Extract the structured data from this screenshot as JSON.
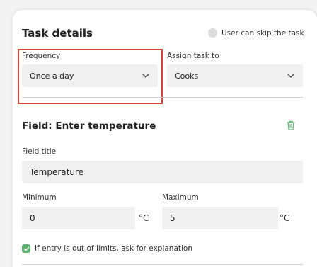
{
  "task_details": {
    "title": "Task details",
    "skip_toggle_label": "User can skip the task",
    "frequency": {
      "label": "Frequency",
      "value": "Once a day"
    },
    "assign": {
      "label": "Assign task to",
      "value": "Cooks"
    }
  },
  "field": {
    "heading": "Field: Enter temperature",
    "title_label": "Field title",
    "title_value": "Temperature",
    "minimum": {
      "label": "Minimum",
      "value": "0",
      "unit": "°C"
    },
    "maximum": {
      "label": "Maximum",
      "value": "5",
      "unit": "°C"
    },
    "explanation_checkbox": {
      "label": "If entry is out of limits, ask for explanation",
      "checked": true
    }
  },
  "colors": {
    "highlight": "#d9423b",
    "accent_green": "#5db371",
    "field_background": "#f0f0f0"
  },
  "icons": {
    "dropdown": "chevron-down-icon",
    "delete": "trash-icon",
    "check": "checkmark-icon"
  }
}
